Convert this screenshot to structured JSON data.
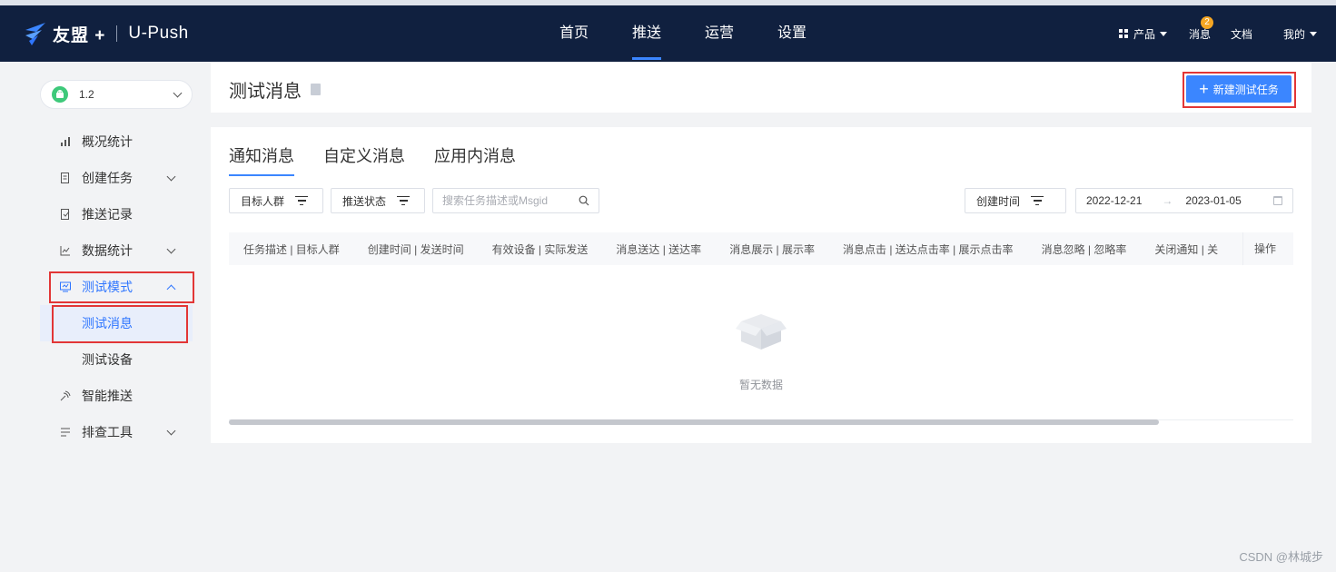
{
  "app": {
    "brand": "友盟 +",
    "product": "U-Push"
  },
  "nav": {
    "items": [
      "首页",
      "推送",
      "运营",
      "设置"
    ],
    "active": "推送"
  },
  "user_nav": {
    "products": "产品",
    "messages": "消息",
    "messages_badge": "2",
    "docs": "文档",
    "mine": "我的"
  },
  "sidebar": {
    "app_version": "1.2",
    "items": [
      {
        "label": "概况统计",
        "icon": "bar-chart-icon",
        "expandable": false
      },
      {
        "label": "创建任务",
        "icon": "document-icon",
        "expandable": true
      },
      {
        "label": "推送记录",
        "icon": "record-icon",
        "expandable": false
      },
      {
        "label": "数据统计",
        "icon": "line-chart-icon",
        "expandable": true
      },
      {
        "label": "测试模式",
        "icon": "monitor-icon",
        "expandable": true,
        "expanded": true,
        "active": true
      },
      {
        "label": "智能推送",
        "icon": "satellite-icon",
        "expandable": false
      },
      {
        "label": "排查工具",
        "icon": "list-icon",
        "expandable": true
      }
    ],
    "sub_items": [
      {
        "label": "测试消息",
        "selected": true
      },
      {
        "label": "测试设备",
        "selected": false
      }
    ]
  },
  "header": {
    "title": "测试消息",
    "new_button": "新建测试任务"
  },
  "tabs": [
    "通知消息",
    "自定义消息",
    "应用内消息"
  ],
  "active_tab": "通知消息",
  "filters": {
    "target": "目标人群",
    "status": "推送状态",
    "search_placeholder": "搜索任务描述或Msgid",
    "sort": "创建时间",
    "date_start": "2022-12-21",
    "date_end": "2023-01-05"
  },
  "table": {
    "columns": [
      "任务描述 | 目标人群",
      "创建时间 | 发送时间",
      "有效设备 | 实际发送",
      "消息送达 | 送达率",
      "消息展示 | 展示率",
      "消息点击 | 送达点击率 | 展示点击率",
      "消息忽略 | 忽略率",
      "关闭通知 | 关"
    ],
    "ops": "操作",
    "empty_text": "暂无数据"
  },
  "watermark": "CSDN @林城步",
  "colors": {
    "nav_bg": "#10203f",
    "accent": "#3b86ff",
    "highlight": "#e23636"
  }
}
